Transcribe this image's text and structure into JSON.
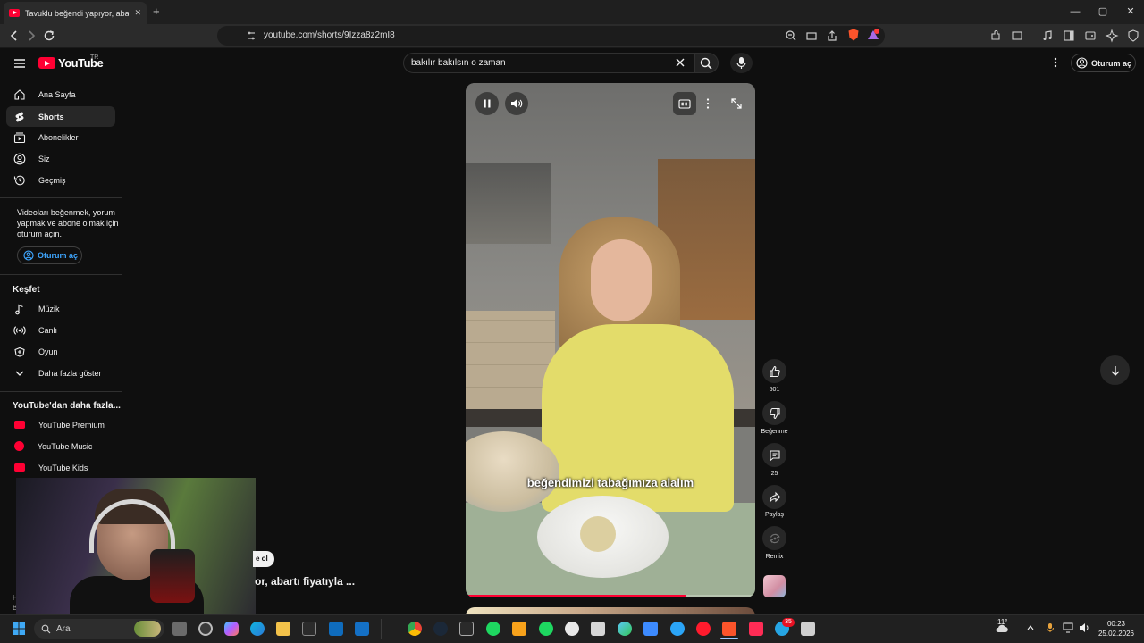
{
  "browser": {
    "tab_title": "Tavuklu beğendi yapıyor, abartı",
    "url": "youtube.com/shorts/9Izza8z2mI8",
    "new_tab_glyph": "+",
    "close_glyph": "✕",
    "minimize_glyph": "—",
    "maximize_glyph": "▢",
    "window_close_glyph": "✕"
  },
  "header": {
    "logo_text": "YouTube",
    "country_code": "TR",
    "search_value": "bakılır bakılsın o zaman",
    "sign_in_label": "Oturum aç"
  },
  "sidebar": {
    "items": [
      {
        "label": "Ana Sayfa",
        "icon": "home-icon"
      },
      {
        "label": "Shorts",
        "icon": "shorts-icon"
      },
      {
        "label": "Abonelikler",
        "icon": "subscriptions-icon"
      },
      {
        "label": "Siz",
        "icon": "you-icon"
      },
      {
        "label": "Geçmiş",
        "icon": "history-icon"
      }
    ],
    "signin_message": "Videoları beğenmek, yorum yapmak ve abone olmak için oturum açın.",
    "signin_button": "Oturum aç",
    "explore_title": "Keşfet",
    "explore_items": [
      {
        "label": "Müzik",
        "icon": "music-note-icon"
      },
      {
        "label": "Canlı",
        "icon": "live-icon"
      },
      {
        "label": "Oyun",
        "icon": "gaming-icon"
      },
      {
        "label": "Daha fazla göster",
        "icon": "chevron-down-icon"
      }
    ],
    "more_title": "YouTube'dan daha fazla...",
    "more_items": [
      {
        "label": "YouTube Premium"
      },
      {
        "label": "YouTube Music"
      },
      {
        "label": "YouTube Kids"
      }
    ],
    "footer_line1": "Ha",
    "footer_line2": "Bize"
  },
  "player": {
    "caption": "beğendimizi tabağımıza alalım",
    "progress_percent": 76
  },
  "actions": {
    "like_count": "501",
    "dislike_label": "Beğenme",
    "comment_count": "25",
    "share_label": "Paylaş",
    "remix_label": "Remix"
  },
  "peek": {
    "chip_text": "e ol",
    "title_text": "or, abartı fiyatıyla ..."
  },
  "taskbar": {
    "search_placeholder": "Ara",
    "temperature": "11°",
    "time": "00:23",
    "date": "25.02.2026",
    "notification_badge": "35"
  },
  "colors": {
    "brand_red": "#ff0033",
    "background": "#0f0f0f",
    "link_blue": "#3ea6ff"
  }
}
